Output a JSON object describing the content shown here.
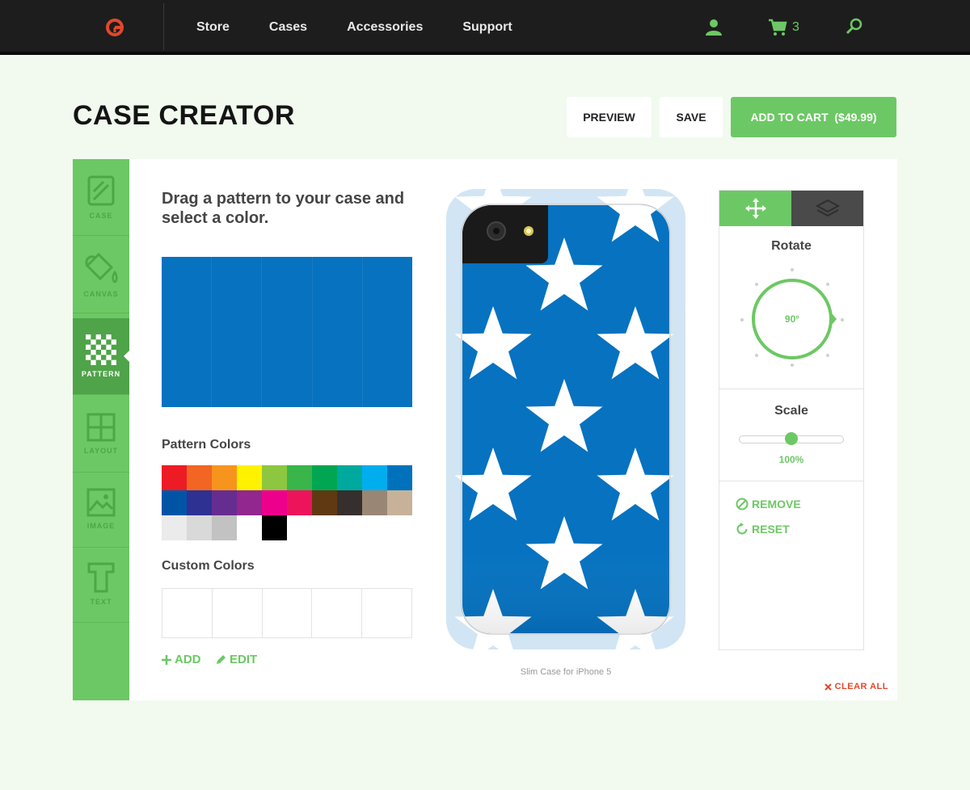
{
  "nav": {
    "links": [
      "Store",
      "Cases",
      "Accessories",
      "Support"
    ],
    "cart_count": "3",
    "icons": [
      "logo-icon",
      "user-icon",
      "cart-icon",
      "search-icon"
    ]
  },
  "header": {
    "title": "CASE CREATOR",
    "preview_label": "PREVIEW",
    "save_label": "SAVE",
    "add_to_cart_label": "ADD TO CART  ($49.99)"
  },
  "sidebar": {
    "items": [
      {
        "label": "CASE",
        "icon": "case-icon"
      },
      {
        "label": "CANVAS",
        "icon": "paint-bucket-icon"
      },
      {
        "label": "PATTERN",
        "icon": "checkerboard-icon",
        "active": true
      },
      {
        "label": "LAYOUT",
        "icon": "layout-grid-icon"
      },
      {
        "label": "IMAGE",
        "icon": "image-icon"
      },
      {
        "label": "TEXT",
        "icon": "text-icon"
      }
    ]
  },
  "editor": {
    "instructions": "Drag a pattern to your case and select a color.",
    "pattern_colors_label": "Pattern Colors",
    "custom_colors_label": "Custom Colors",
    "add_label": "ADD",
    "edit_label": "EDIT",
    "case_caption": "Slim Case for iPhone 5",
    "pattern_color": "#0672c0",
    "palette": [
      "#ed1c24",
      "#f26522",
      "#f7941d",
      "#fff200",
      "#8dc63f",
      "#39b54a",
      "#00a651",
      "#00a99d",
      "#00aeef",
      "#0072bc",
      "#0054a6",
      "#2e3192",
      "#662d91",
      "#92278f",
      "#ec008c",
      "#ed145b",
      "#603913",
      "#362f2d",
      "#998675",
      "#c7b299",
      "#ebebeb",
      "#d9d9d9",
      "#c2c2c2",
      "#ffffff",
      "#000000"
    ]
  },
  "tools": {
    "rotate_label": "Rotate",
    "rotate_value": "90°",
    "scale_label": "Scale",
    "scale_value": "100%",
    "scale_fraction": 0.5,
    "remove_label": "REMOVE",
    "reset_label": "RESET"
  },
  "clear_all_label": "CLEAR ALL",
  "colors": {
    "accent": "#6cc864",
    "danger": "#e4472a",
    "nav_bg": "#1d1d1d"
  }
}
